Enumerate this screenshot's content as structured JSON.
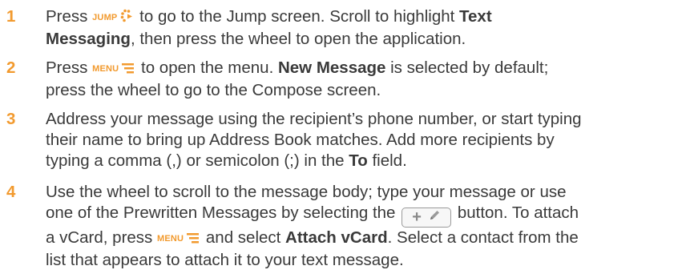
{
  "steps": [
    {
      "number": "1",
      "lines": [
        {
          "a": "Press ",
          "key": "JUMP",
          "b": " to go to the Jump screen. Scroll to highlight ",
          "bold": "Text"
        },
        {
          "bold": "Messaging",
          "a": ", then press the wheel to open the application."
        }
      ]
    },
    {
      "number": "2",
      "lines": [
        {
          "a": "Press ",
          "key": "MENU",
          "b": " to open the menu. ",
          "bold": "New Message",
          "c": " is selected by default;"
        },
        {
          "a": "press the wheel to go to the Compose screen."
        }
      ]
    },
    {
      "number": "3",
      "lines": [
        {
          "a": "Address your message using the recipient’s phone number, or start typing"
        },
        {
          "a": "their name to bring up Address Book matches. Add more recipients by"
        },
        {
          "a": "typing a comma (,) or semicolon (;) in the ",
          "bold": "To",
          "b": " field."
        }
      ]
    },
    {
      "number": "4",
      "lines": [
        {
          "a": "Use the wheel to scroll to the message body; type your message or use"
        },
        {
          "a": "one of the Prewritten Messages by selecting the ",
          "b": " button. To attach"
        },
        {
          "a": "a vCard, press ",
          "key": "MENU",
          "b": " and select ",
          "bold": "Attach vCard",
          "c": ". Select a contact from the"
        },
        {
          "a": "list that appears to attach it to your text message."
        }
      ]
    }
  ],
  "icons": {
    "jump": "jump-dots-icon",
    "menu": "menu-lines-icon",
    "plus": "plus-icon",
    "pencil": "pencil-icon"
  },
  "colors": {
    "accent": "#f29a2e",
    "text": "#3a3a3a",
    "button_border": "#9a9a9a"
  }
}
